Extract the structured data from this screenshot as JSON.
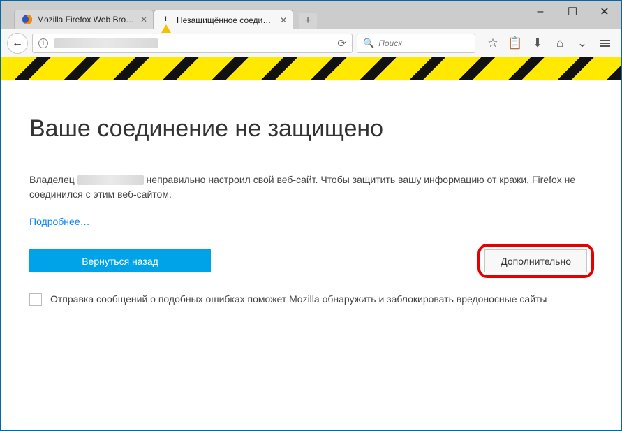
{
  "window_controls": {
    "minimize": "–",
    "maximize": "☐",
    "close": "✕"
  },
  "tabs": [
    {
      "label": "Mozilla Firefox Web Brows…",
      "active": false,
      "favicon": "firefox"
    },
    {
      "label": "Незащищённое соедине…",
      "active": true,
      "favicon": "warning"
    }
  ],
  "newtab_label": "+",
  "navbar": {
    "back_glyph": "←",
    "info_glyph": "i",
    "reload_glyph": "⟳",
    "search_placeholder": "Поиск",
    "search_icon_glyph": "🔍"
  },
  "toolbar_icons": {
    "star": "☆",
    "clipboard": "📋",
    "download": "⬇",
    "home": "⌂",
    "pocket": "⌄"
  },
  "error": {
    "heading": "Ваше соединение не защищено",
    "owner_prefix": "Владелец ",
    "owner_suffix": " неправильно настроил свой веб-сайт. Чтобы защитить вашу информацию от кражи, Firefox не соединился с этим веб-сайтом.",
    "learn_more": "Подробнее…",
    "go_back": "Вернуться назад",
    "advanced": "Дополнительно",
    "report_checkbox": "Отправка сообщений о подобных ошибках поможет Mozilla обнаружить и заблокировать вредоносные сайты"
  }
}
